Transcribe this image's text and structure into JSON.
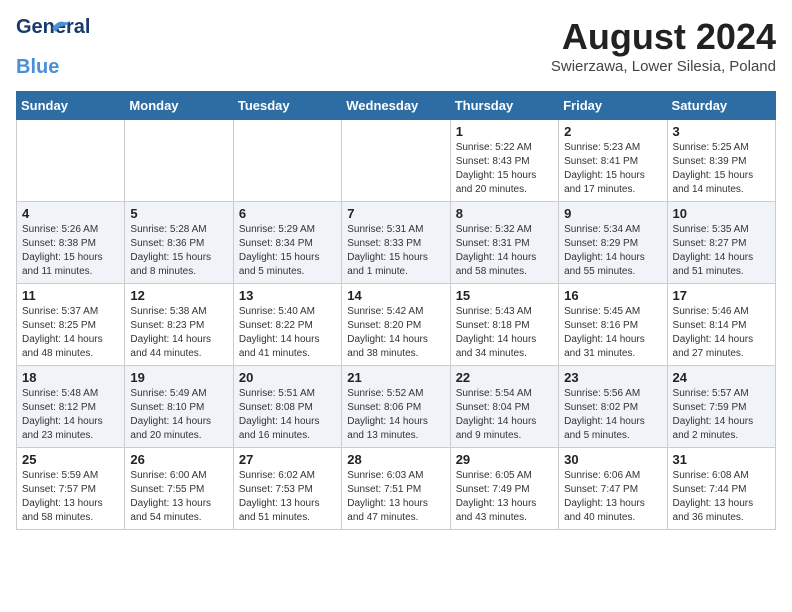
{
  "header": {
    "logo_general": "General",
    "logo_blue": "Blue",
    "month": "August 2024",
    "location": "Swierzawa, Lower Silesia, Poland"
  },
  "days_of_week": [
    "Sunday",
    "Monday",
    "Tuesday",
    "Wednesday",
    "Thursday",
    "Friday",
    "Saturday"
  ],
  "weeks": [
    [
      {
        "day": "",
        "info": ""
      },
      {
        "day": "",
        "info": ""
      },
      {
        "day": "",
        "info": ""
      },
      {
        "day": "",
        "info": ""
      },
      {
        "day": "1",
        "info": "Sunrise: 5:22 AM\nSunset: 8:43 PM\nDaylight: 15 hours\nand 20 minutes."
      },
      {
        "day": "2",
        "info": "Sunrise: 5:23 AM\nSunset: 8:41 PM\nDaylight: 15 hours\nand 17 minutes."
      },
      {
        "day": "3",
        "info": "Sunrise: 5:25 AM\nSunset: 8:39 PM\nDaylight: 15 hours\nand 14 minutes."
      }
    ],
    [
      {
        "day": "4",
        "info": "Sunrise: 5:26 AM\nSunset: 8:38 PM\nDaylight: 15 hours\nand 11 minutes."
      },
      {
        "day": "5",
        "info": "Sunrise: 5:28 AM\nSunset: 8:36 PM\nDaylight: 15 hours\nand 8 minutes."
      },
      {
        "day": "6",
        "info": "Sunrise: 5:29 AM\nSunset: 8:34 PM\nDaylight: 15 hours\nand 5 minutes."
      },
      {
        "day": "7",
        "info": "Sunrise: 5:31 AM\nSunset: 8:33 PM\nDaylight: 15 hours\nand 1 minute."
      },
      {
        "day": "8",
        "info": "Sunrise: 5:32 AM\nSunset: 8:31 PM\nDaylight: 14 hours\nand 58 minutes."
      },
      {
        "day": "9",
        "info": "Sunrise: 5:34 AM\nSunset: 8:29 PM\nDaylight: 14 hours\nand 55 minutes."
      },
      {
        "day": "10",
        "info": "Sunrise: 5:35 AM\nSunset: 8:27 PM\nDaylight: 14 hours\nand 51 minutes."
      }
    ],
    [
      {
        "day": "11",
        "info": "Sunrise: 5:37 AM\nSunset: 8:25 PM\nDaylight: 14 hours\nand 48 minutes."
      },
      {
        "day": "12",
        "info": "Sunrise: 5:38 AM\nSunset: 8:23 PM\nDaylight: 14 hours\nand 44 minutes."
      },
      {
        "day": "13",
        "info": "Sunrise: 5:40 AM\nSunset: 8:22 PM\nDaylight: 14 hours\nand 41 minutes."
      },
      {
        "day": "14",
        "info": "Sunrise: 5:42 AM\nSunset: 8:20 PM\nDaylight: 14 hours\nand 38 minutes."
      },
      {
        "day": "15",
        "info": "Sunrise: 5:43 AM\nSunset: 8:18 PM\nDaylight: 14 hours\nand 34 minutes."
      },
      {
        "day": "16",
        "info": "Sunrise: 5:45 AM\nSunset: 8:16 PM\nDaylight: 14 hours\nand 31 minutes."
      },
      {
        "day": "17",
        "info": "Sunrise: 5:46 AM\nSunset: 8:14 PM\nDaylight: 14 hours\nand 27 minutes."
      }
    ],
    [
      {
        "day": "18",
        "info": "Sunrise: 5:48 AM\nSunset: 8:12 PM\nDaylight: 14 hours\nand 23 minutes."
      },
      {
        "day": "19",
        "info": "Sunrise: 5:49 AM\nSunset: 8:10 PM\nDaylight: 14 hours\nand 20 minutes."
      },
      {
        "day": "20",
        "info": "Sunrise: 5:51 AM\nSunset: 8:08 PM\nDaylight: 14 hours\nand 16 minutes."
      },
      {
        "day": "21",
        "info": "Sunrise: 5:52 AM\nSunset: 8:06 PM\nDaylight: 14 hours\nand 13 minutes."
      },
      {
        "day": "22",
        "info": "Sunrise: 5:54 AM\nSunset: 8:04 PM\nDaylight: 14 hours\nand 9 minutes."
      },
      {
        "day": "23",
        "info": "Sunrise: 5:56 AM\nSunset: 8:02 PM\nDaylight: 14 hours\nand 5 minutes."
      },
      {
        "day": "24",
        "info": "Sunrise: 5:57 AM\nSunset: 7:59 PM\nDaylight: 14 hours\nand 2 minutes."
      }
    ],
    [
      {
        "day": "25",
        "info": "Sunrise: 5:59 AM\nSunset: 7:57 PM\nDaylight: 13 hours\nand 58 minutes."
      },
      {
        "day": "26",
        "info": "Sunrise: 6:00 AM\nSunset: 7:55 PM\nDaylight: 13 hours\nand 54 minutes."
      },
      {
        "day": "27",
        "info": "Sunrise: 6:02 AM\nSunset: 7:53 PM\nDaylight: 13 hours\nand 51 minutes."
      },
      {
        "day": "28",
        "info": "Sunrise: 6:03 AM\nSunset: 7:51 PM\nDaylight: 13 hours\nand 47 minutes."
      },
      {
        "day": "29",
        "info": "Sunrise: 6:05 AM\nSunset: 7:49 PM\nDaylight: 13 hours\nand 43 minutes."
      },
      {
        "day": "30",
        "info": "Sunrise: 6:06 AM\nSunset: 7:47 PM\nDaylight: 13 hours\nand 40 minutes."
      },
      {
        "day": "31",
        "info": "Sunrise: 6:08 AM\nSunset: 7:44 PM\nDaylight: 13 hours\nand 36 minutes."
      }
    ]
  ]
}
